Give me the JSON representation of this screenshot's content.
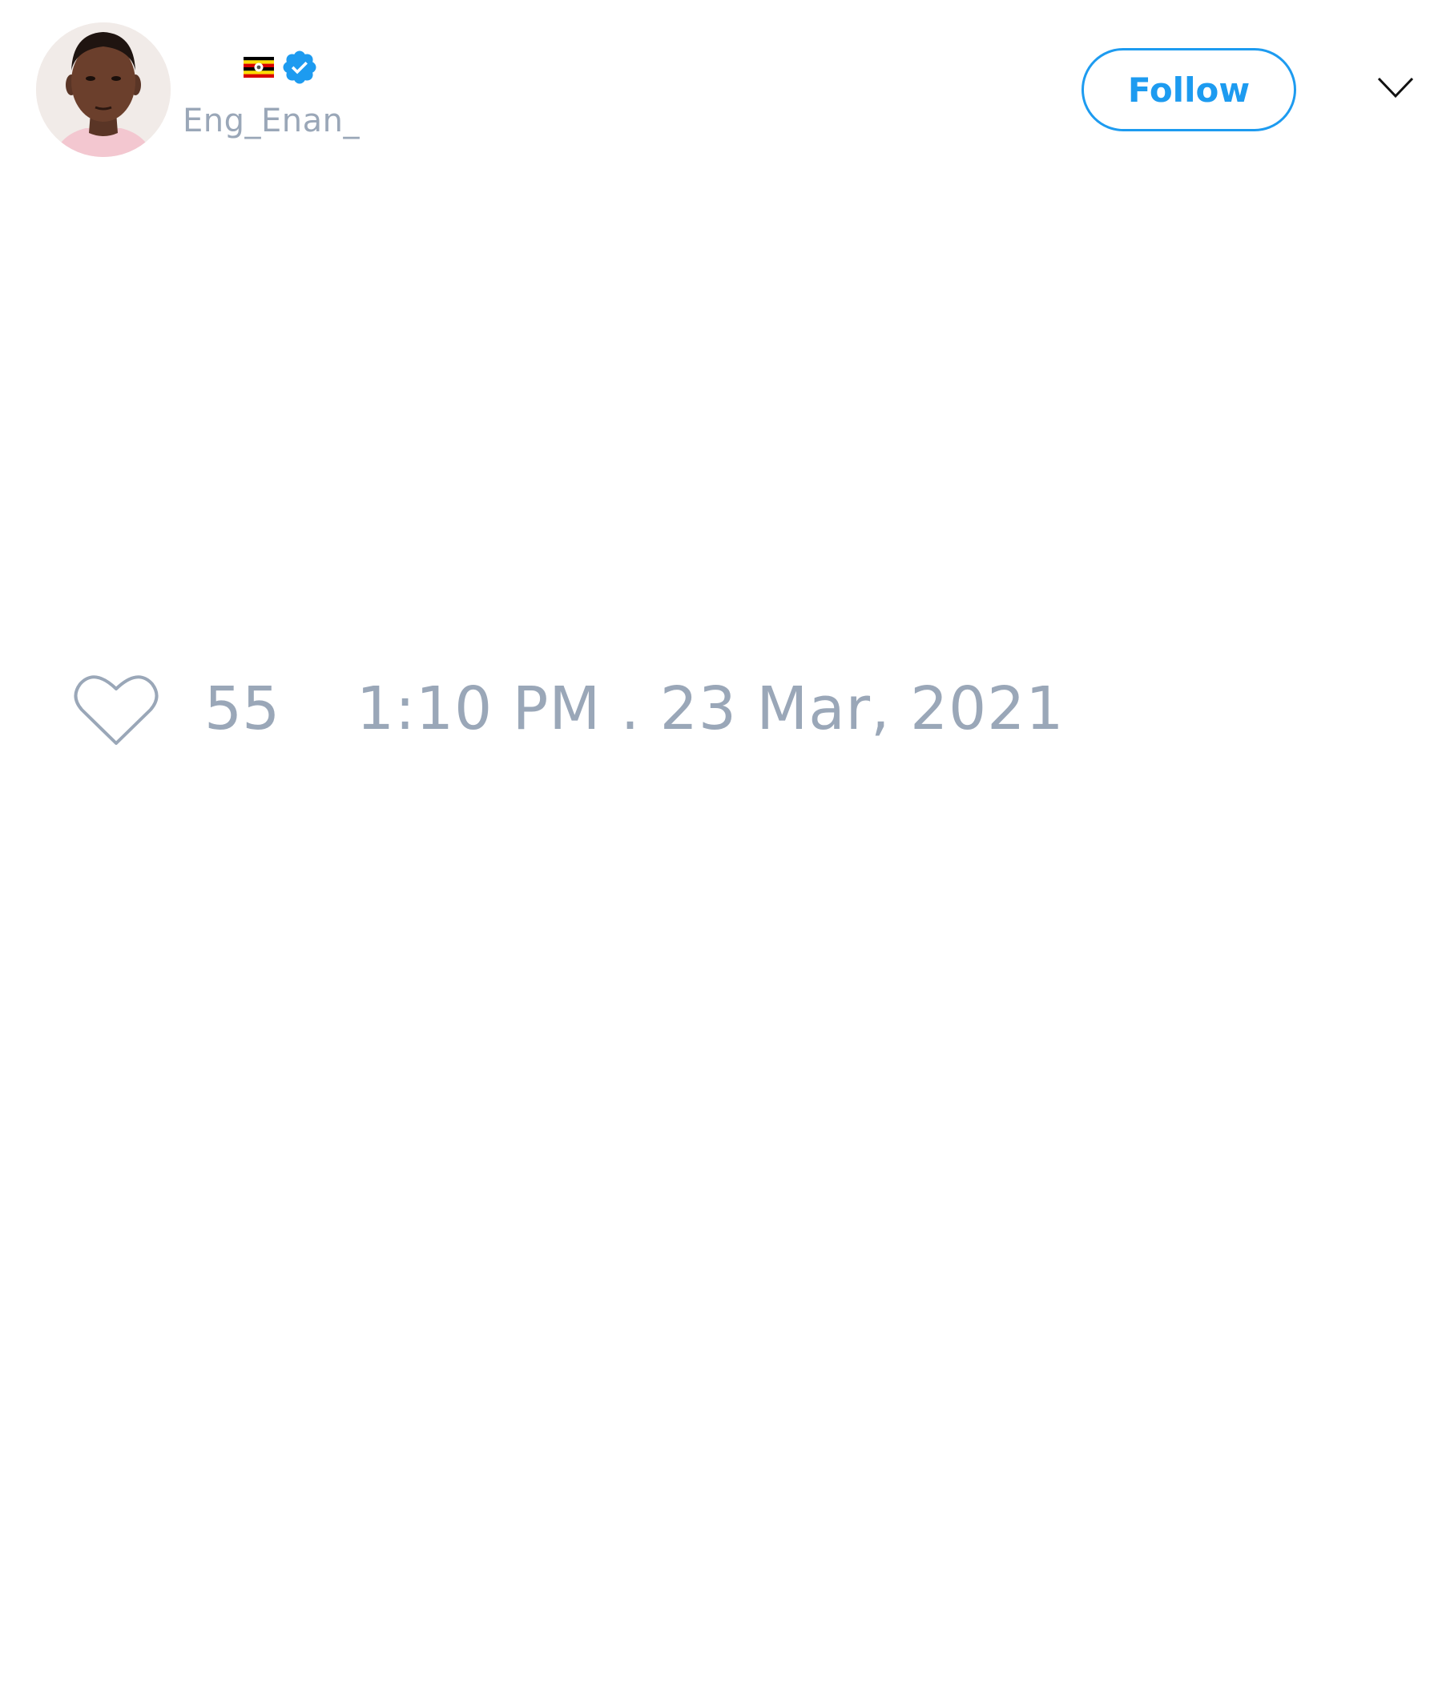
{
  "colors": {
    "accent": "#1d9bf0",
    "muted_text": "#9aa7b8",
    "background": "#ffffff"
  },
  "user": {
    "handle": "Eng_Enan_",
    "flag_icon": "uganda-flag-icon",
    "verified_icon": "verified-badge-icon"
  },
  "actions": {
    "follow_label": "Follow",
    "menu_icon": "chevron-down-icon"
  },
  "stats": {
    "like_icon": "heart-icon",
    "likes": "55",
    "timestamp": "1:10 PM . 23 Mar, 2021"
  }
}
